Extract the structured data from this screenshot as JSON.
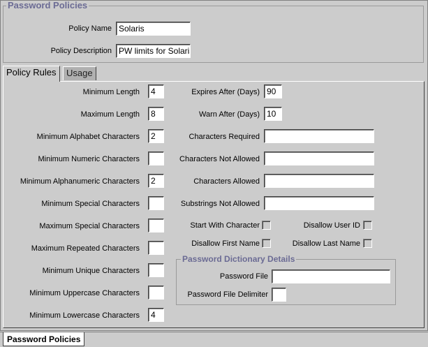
{
  "policies": {
    "title": "Password Policies",
    "name_label": "Policy Name",
    "name_value": "Solaris",
    "desc_label": "Policy Description",
    "desc_value": "PW limits for Solaris"
  },
  "tabs": [
    {
      "label": "Policy Rules",
      "active": true
    },
    {
      "label": "Usage",
      "active": false
    }
  ],
  "rules_left": [
    {
      "label": "Minimum Length",
      "value": "4"
    },
    {
      "label": "Maximum Length",
      "value": "8"
    },
    {
      "label": "Minimum Alphabet Characters",
      "value": "2"
    },
    {
      "label": "Minimum Numeric Characters",
      "value": ""
    },
    {
      "label": "Minimum Alphanumeric Characters",
      "value": "2"
    },
    {
      "label": "Minimum Special Characters",
      "value": ""
    },
    {
      "label": "Maximum Special Characters",
      "value": ""
    },
    {
      "label": "Maximum Repeated Characters",
      "value": ""
    },
    {
      "label": "Minimum Unique Characters",
      "value": ""
    },
    {
      "label": "Minimum Uppercase Characters",
      "value": ""
    },
    {
      "label": "Minimum Lowercase Characters",
      "value": "4"
    }
  ],
  "rules_right": {
    "expires_label": "Expires After (Days)",
    "expires_value": "90",
    "warn_label": "Warn After (Days)",
    "warn_value": "10",
    "required_label": "Characters Required",
    "required_value": "",
    "not_allowed_label": "Characters Not Allowed",
    "not_allowed_value": "",
    "allowed_label": "Characters Allowed",
    "allowed_value": "",
    "substrings_label": "Substrings Not Allowed",
    "substrings_value": ""
  },
  "checks": {
    "start_with_char": "Start With Character",
    "disallow_user_id": "Disallow User ID",
    "disallow_first_name": "Disallow First Name",
    "disallow_last_name": "Disallow Last Name"
  },
  "dictionary": {
    "title": "Password Dictionary Details",
    "file_label": "Password File",
    "file_value": "",
    "delim_label": "Password File Delimiter",
    "delim_value": ""
  },
  "bottom_tab": "Password Policies"
}
